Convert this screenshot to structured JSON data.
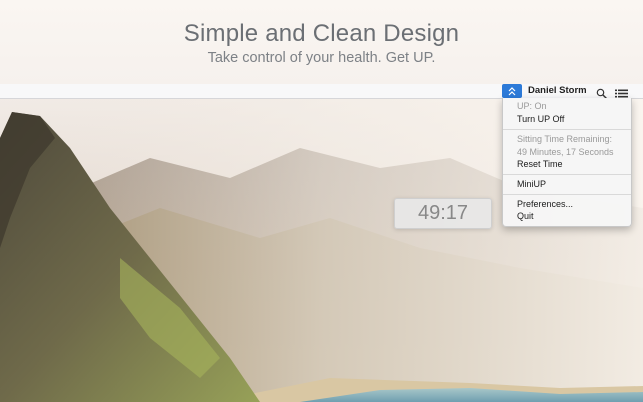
{
  "header": {
    "title": "Simple and Clean Design",
    "subtitle": "Take control of your health. Get UP."
  },
  "menubar": {
    "app_icon": "up-arrows-icon",
    "user_name": "Daniel Storm",
    "search_icon": "search-icon",
    "list_icon": "list-icon",
    "accent_color": "#2c7ad8"
  },
  "dropdown": {
    "status_label": "UP: On",
    "turn_off_label": "Turn UP Off",
    "sitting_time_heading": "Sitting Time Remaining:",
    "sitting_time_value": "49 Minutes, 17 Seconds",
    "reset_time_label": "Reset Time",
    "miniup_label": "MiniUP",
    "preferences_label": "Preferences...",
    "quit_label": "Quit"
  },
  "timer": {
    "value": "49:17"
  }
}
